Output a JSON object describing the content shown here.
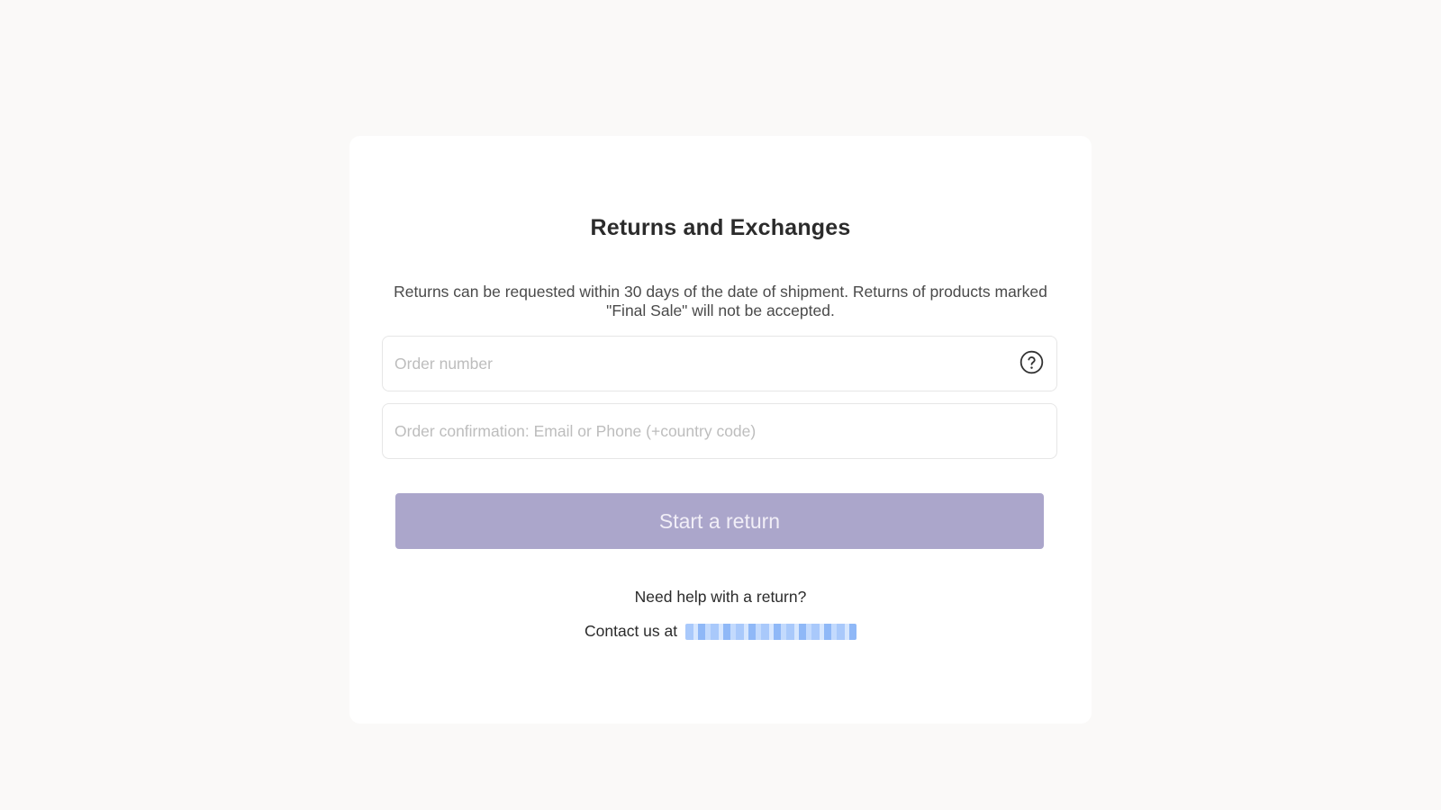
{
  "card": {
    "title": "Returns and Exchanges",
    "description": "Returns can be requested within 30 days of the date of shipment. Returns of products marked \"Final Sale\" will not be accepted."
  },
  "form": {
    "order_number_placeholder": "Order number",
    "order_number_value": "",
    "help_icon": "question-circle-icon",
    "contact_placeholder": "Order confirmation: Email or Phone (+country code)",
    "contact_value": "",
    "submit_label": "Start a return"
  },
  "footer": {
    "help_text": "Need help with a return?",
    "contact_prefix": "Contact us at",
    "contact_email": ""
  },
  "colors": {
    "page_background": "#faf9f8",
    "button_background": "#aba6cb",
    "button_text": "#f1eef7",
    "link": "#a9c9fb"
  }
}
